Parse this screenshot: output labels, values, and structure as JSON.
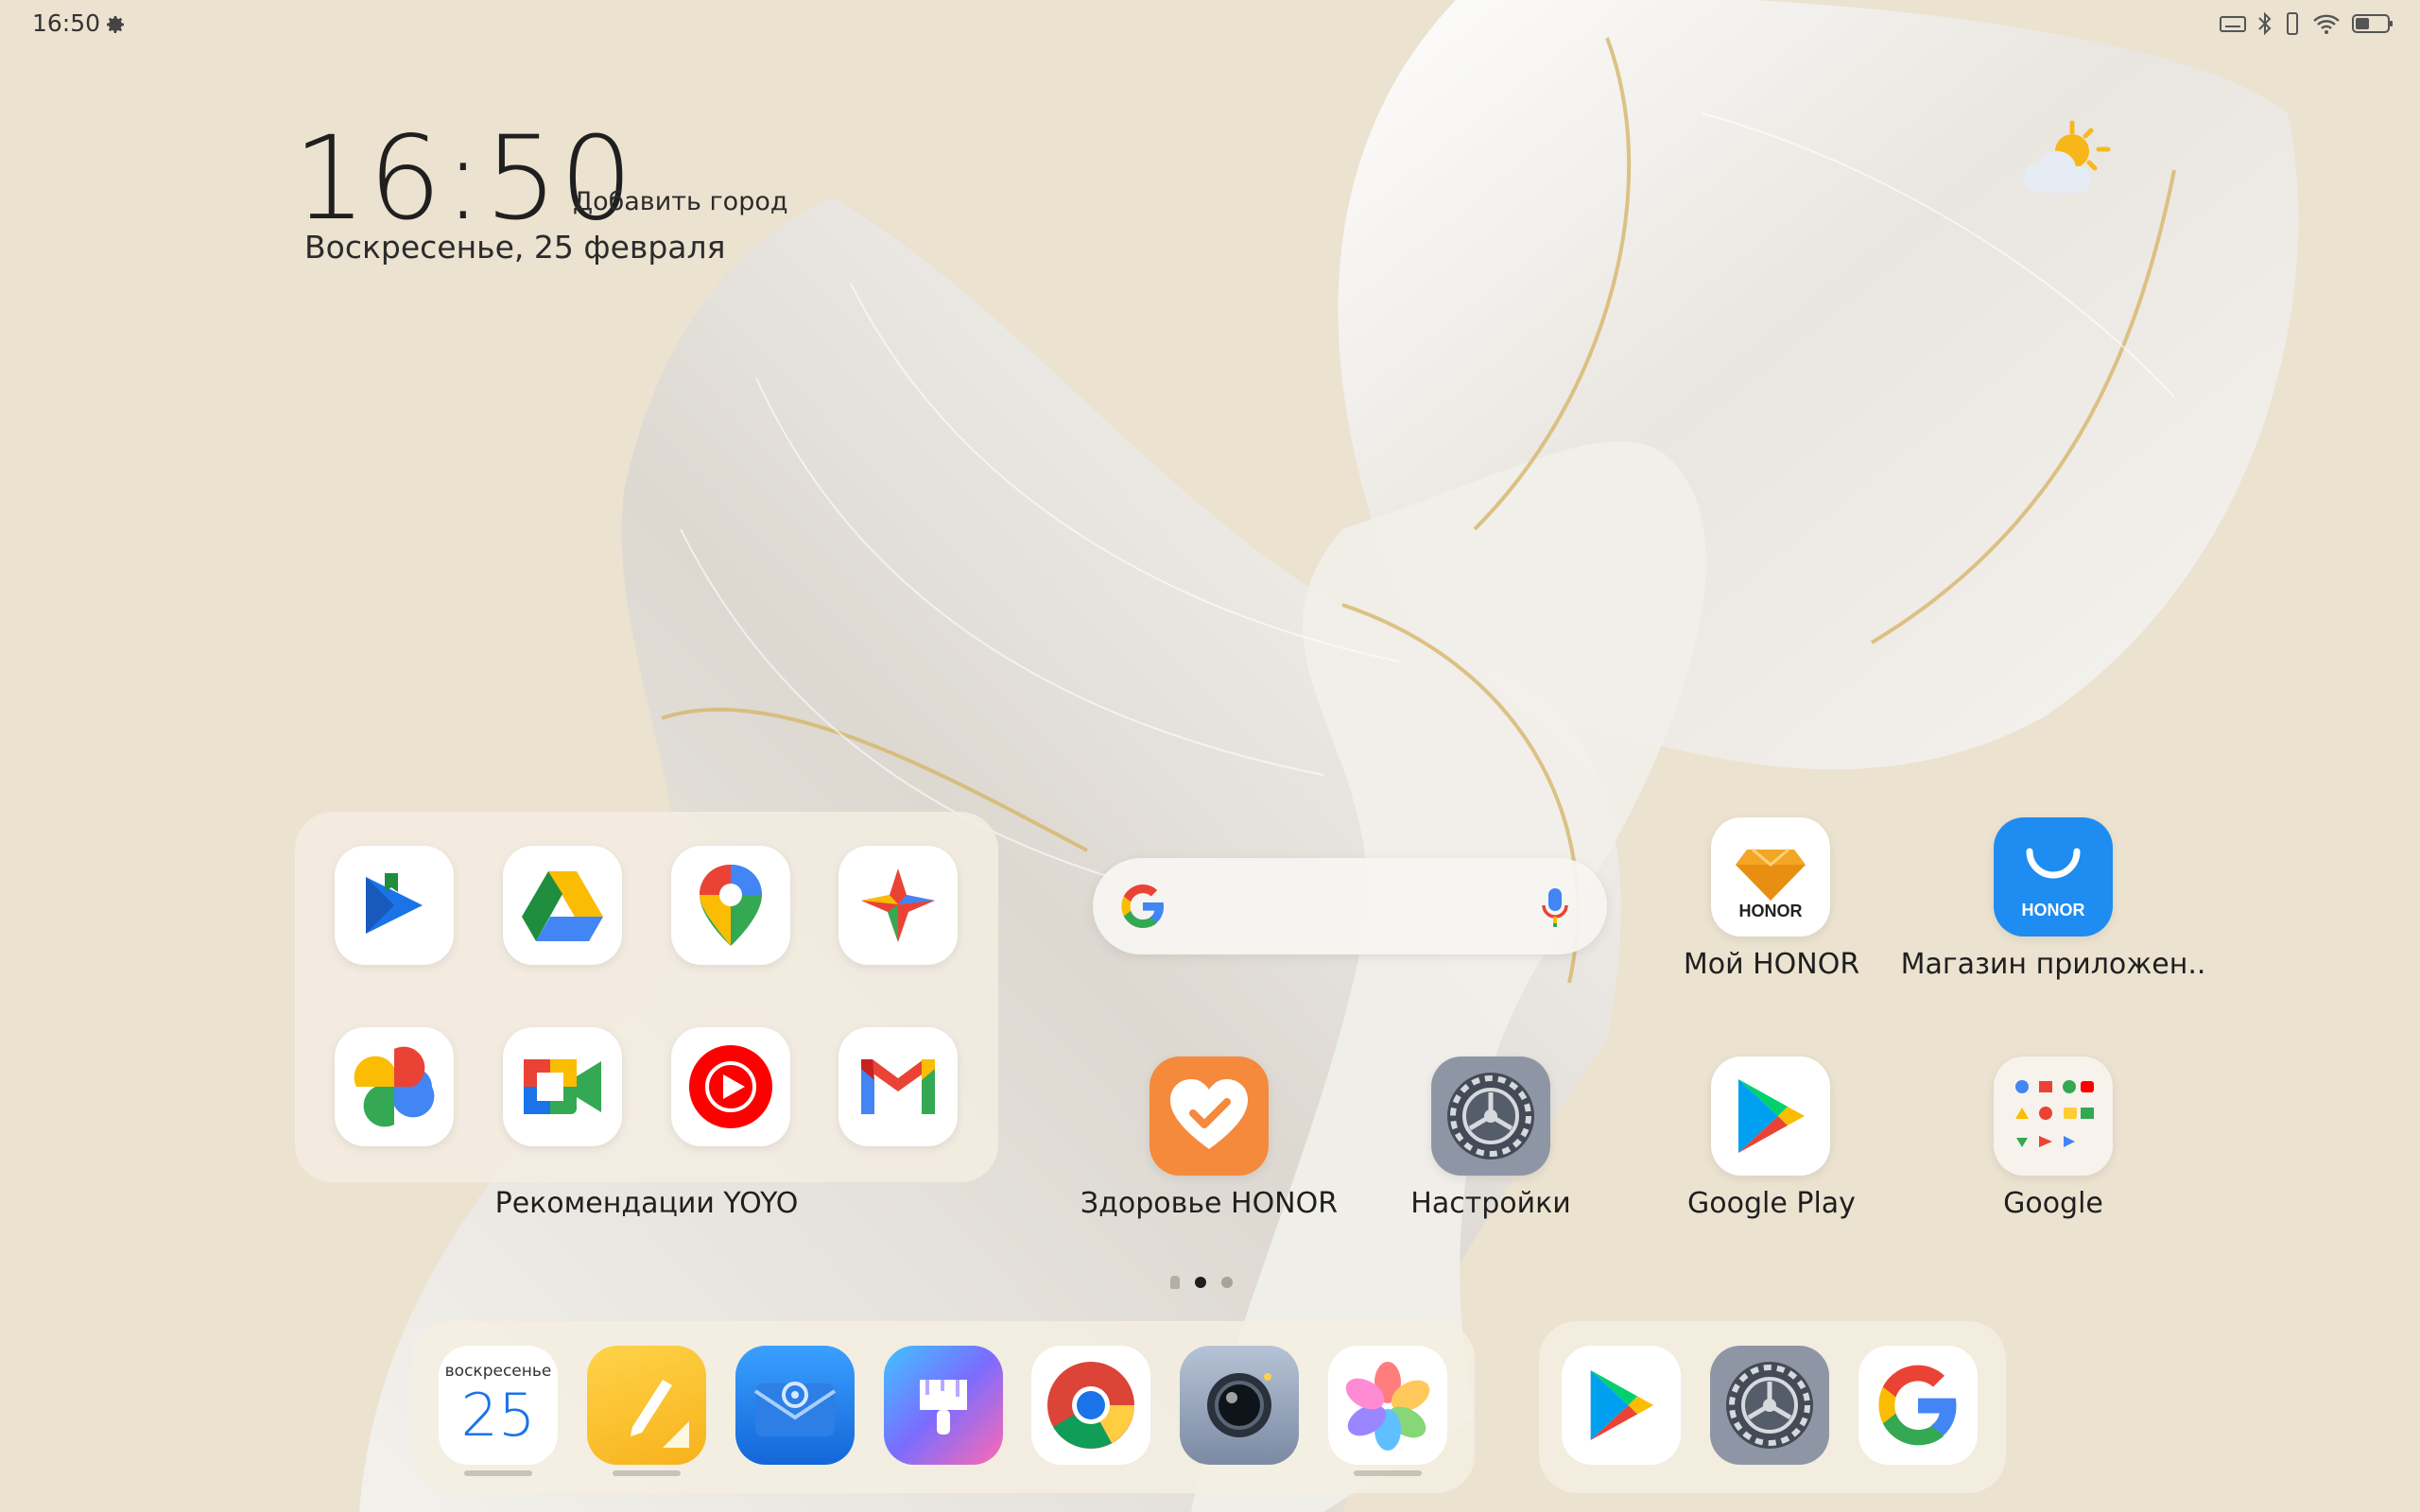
{
  "status_bar": {
    "time": "16:50",
    "icons": [
      "gear-icon",
      "keyboard-icon",
      "bluetooth-icon",
      "vibrate-icon",
      "wifi-icon",
      "battery-icon"
    ]
  },
  "clock_widget": {
    "time": "16:50",
    "add_city": "Добавить город",
    "date": "Воскресенье, 25 февраля"
  },
  "weather_widget": {
    "icon": "partly-sunny-icon"
  },
  "yoyo_folder": {
    "label": "Рекомендации YOYO",
    "apps": [
      {
        "name": "play-books",
        "icon": "play-books-icon"
      },
      {
        "name": "google-drive",
        "icon": "drive-icon"
      },
      {
        "name": "google-maps",
        "icon": "maps-icon"
      },
      {
        "name": "google-travel",
        "icon": "travel-icon"
      },
      {
        "name": "google-photos",
        "icon": "photos-icon"
      },
      {
        "name": "google-meet",
        "icon": "meet-icon"
      },
      {
        "name": "youtube-music",
        "icon": "youtube-music-icon"
      },
      {
        "name": "gmail",
        "icon": "gmail-icon"
      }
    ]
  },
  "search_widget": {
    "icons": [
      "google-g-icon",
      "microphone-icon"
    ]
  },
  "home_apps": [
    {
      "label": "Мой HONOR",
      "icon": "honor-diamond-icon",
      "badge": "HONOR"
    },
    {
      "label": "Магазин приложен..",
      "icon": "honor-store-icon",
      "badge": "HONOR"
    },
    {
      "label": "Здоровье HONOR",
      "icon": "health-heart-icon"
    },
    {
      "label": "Настройки",
      "icon": "settings-gear-icon"
    },
    {
      "label": "Google Play",
      "icon": "google-play-icon"
    },
    {
      "label": "Google",
      "icon": "google-folder-icon"
    }
  ],
  "page_indicator": {
    "pages": 2,
    "active": 1
  },
  "dock": {
    "calendar": {
      "weekday": "воскресенье",
      "day": "25"
    },
    "apps": [
      "calendar-icon",
      "notes-icon",
      "email-icon",
      "themes-icon",
      "chrome-icon",
      "camera-icon",
      "gallery-icon"
    ],
    "recent": [
      "google-play-icon",
      "settings-gear-icon",
      "google-g-icon"
    ]
  },
  "colors": {
    "background": "#ebe2d0",
    "honor_blue": "#1e8cf0",
    "health_orange": "#f58a3c",
    "notes_yellow": "#f7b21b"
  }
}
